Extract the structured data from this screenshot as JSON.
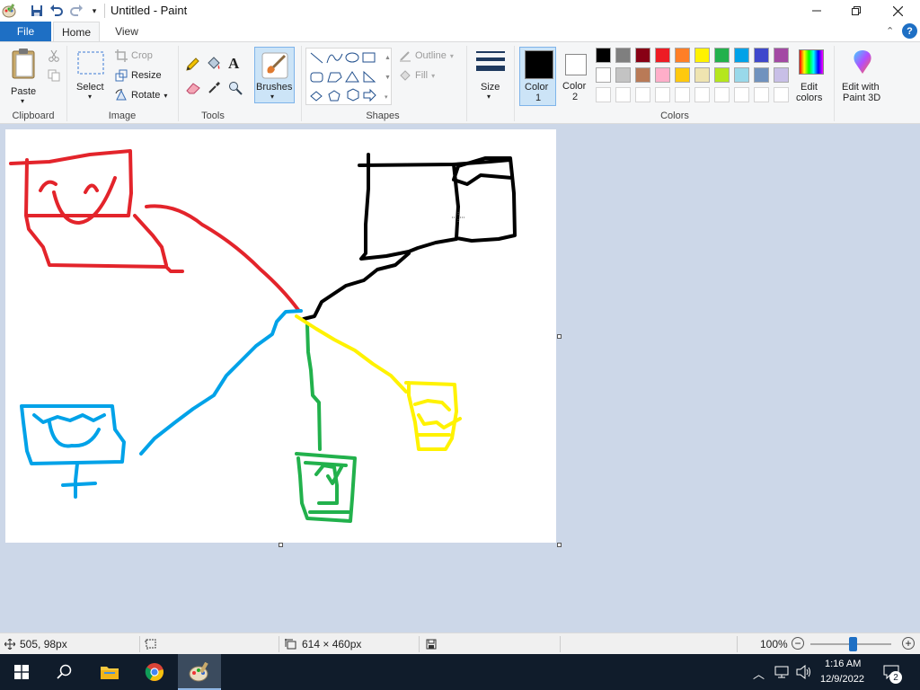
{
  "app": {
    "title": "Untitled - Paint"
  },
  "tabs": [
    {
      "label": "File"
    },
    {
      "label": "Home"
    },
    {
      "label": "View"
    }
  ],
  "ribbon": {
    "clipboard": {
      "paste": "Paste",
      "label": "Clipboard"
    },
    "image": {
      "select": "Select",
      "crop": "Crop",
      "resize": "Resize",
      "rotate": "Rotate",
      "label": "Image"
    },
    "tools": {
      "label": "Tools"
    },
    "brushes": {
      "label": "Brushes"
    },
    "shapes": {
      "outline": "Outline",
      "fill": "Fill",
      "label": "Shapes"
    },
    "size": {
      "label": "Size"
    },
    "color1": {
      "label": "Color",
      "num": "1",
      "value": "#000000"
    },
    "color2": {
      "label": "Color",
      "num": "2",
      "value": "#ffffff"
    },
    "colors": {
      "label": "Colors",
      "row1": [
        "#000000",
        "#7f7f7f",
        "#880015",
        "#ed1c24",
        "#ff7f27",
        "#fff200",
        "#22b14c",
        "#00a2e8",
        "#3f48cc",
        "#a349a4"
      ],
      "row2": [
        "#ffffff",
        "#c3c3c3",
        "#b97a57",
        "#ffaec9",
        "#ffc90e",
        "#efe4b0",
        "#b5e61d",
        "#99d9ea",
        "#7092be",
        "#c8bfe7"
      ]
    },
    "edit_colors": {
      "line1": "Edit",
      "line2": "colors"
    },
    "edit_paint3d": {
      "line1": "Edit with",
      "line2": "Paint 3D"
    }
  },
  "status": {
    "cursor_pos": "505, 98px",
    "canvas_size": "614 × 460px",
    "zoom": "100%"
  },
  "taskbar": {
    "time": "1:16 AM",
    "date": "12/9/2022",
    "notifications": "2"
  }
}
